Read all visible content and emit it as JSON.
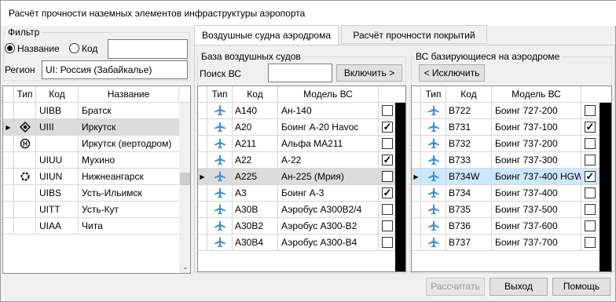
{
  "window": {
    "title": "Расчёт прочности наземных элементов инфраструктуры аэропорта"
  },
  "filter": {
    "label": "Фильтр",
    "radio_name": "Название",
    "radio_code": "Код",
    "code_value": "",
    "region_label": "Регион",
    "region_value": "UI: Россия (Забайкалье)"
  },
  "airports": {
    "headers": [
      "Тип",
      "Код",
      "Название"
    ],
    "rows": [
      {
        "type_icon": "",
        "code": "UIBB",
        "name": "Братск"
      },
      {
        "type_icon": "airport-diamond-icon",
        "code": "UIII",
        "name": "Иркутск",
        "selected": true
      },
      {
        "type_icon": "heliport-icon",
        "code": "",
        "name": "Иркутск (вертодром)"
      },
      {
        "type_icon": "",
        "code": "UIUU",
        "name": "Мухино"
      },
      {
        "type_icon": "airport-circle-icon",
        "code": "UIUN",
        "name": "Нижнеангарск"
      },
      {
        "type_icon": "",
        "code": "UIBS",
        "name": "Усть-Ильимск"
      },
      {
        "type_icon": "",
        "code": "UITT",
        "name": "Усть-Кут"
      },
      {
        "type_icon": "",
        "code": "UIAA",
        "name": "Чита"
      }
    ]
  },
  "tabs": [
    {
      "label": "Воздушные судна аэродрома",
      "active": true
    },
    {
      "label": "Расчёт прочности покрытий",
      "active": false
    }
  ],
  "base": {
    "label": "База воздушных судов",
    "search_label": "Поиск ВС",
    "search_value": "",
    "include_button": "Включить >",
    "headers": [
      "Тип",
      "Код",
      "Модель ВС"
    ],
    "rows": [
      {
        "code": "A140",
        "model": "Ан-140",
        "checked": false
      },
      {
        "code": "A20",
        "model": "Боинг А-20 Havoc",
        "checked": true
      },
      {
        "code": "A211",
        "model": "Альфа МА211",
        "checked": false
      },
      {
        "code": "A22",
        "model": "А-22",
        "checked": true
      },
      {
        "code": "A225",
        "model": "Ан-225 (Мрия)",
        "checked": false,
        "selected": true
      },
      {
        "code": "A3",
        "model": "Боинг А-3",
        "checked": true
      },
      {
        "code": "A30B",
        "model": "Аэробус A300B2/4",
        "checked": false
      },
      {
        "code": "A30B2",
        "model": "Аэробус A300-B2",
        "checked": false
      },
      {
        "code": "A30B4",
        "model": "Аэробус A300-B4",
        "checked": false
      }
    ]
  },
  "based": {
    "label": "ВС базирующиеся на аэродроме",
    "exclude_button": "< Исключить",
    "headers": [
      "Тип",
      "Код",
      "Модель ВС"
    ],
    "rows": [
      {
        "code": "B722",
        "model": "Боинг 727-200",
        "checked": false
      },
      {
        "code": "B731",
        "model": "Боинг 737-100",
        "checked": true
      },
      {
        "code": "B732",
        "model": "Боинг 737-200",
        "checked": false
      },
      {
        "code": "B733",
        "model": "Боинг 737-300",
        "checked": false
      },
      {
        "code": "B734W",
        "model": "Боинг 737-400 HGW",
        "checked": true,
        "selected": true
      },
      {
        "code": "B734",
        "model": "Боинг 737-400",
        "checked": false
      },
      {
        "code": "B735",
        "model": "Боинг 737-500",
        "checked": false
      },
      {
        "code": "B736",
        "model": "Боинг 737-600",
        "checked": false
      },
      {
        "code": "B737",
        "model": "Боинг 737-700",
        "checked": false
      }
    ]
  },
  "footer": {
    "calc": "Рассчитать",
    "exit": "Выход",
    "help": "Помощь"
  },
  "colors": {
    "plane": "#3a8fd9",
    "selection": "#cce8ff"
  }
}
